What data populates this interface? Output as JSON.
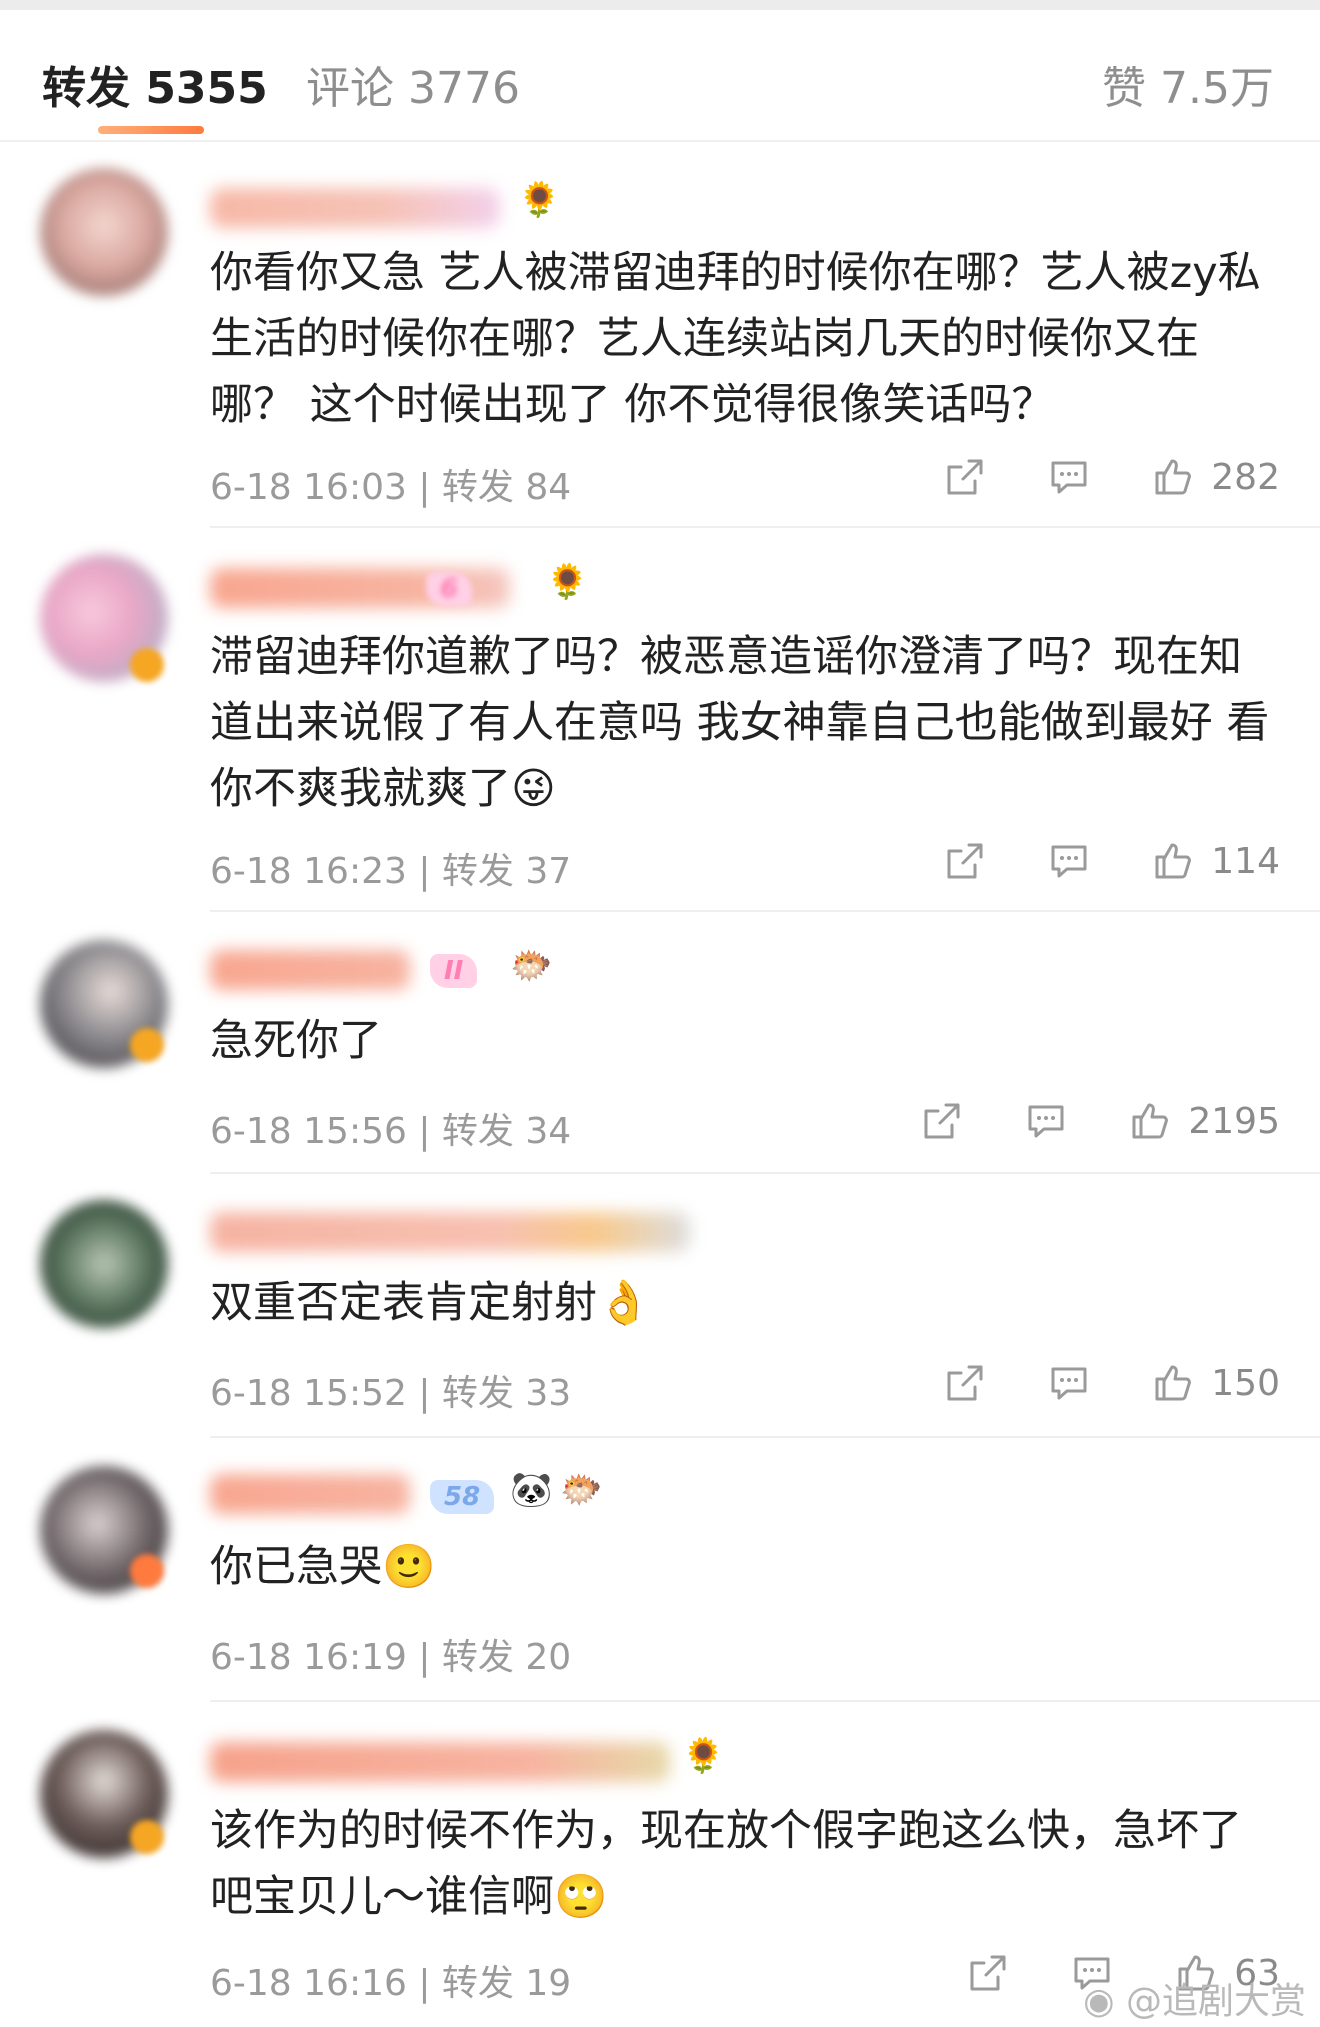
{
  "tabs": {
    "repost_label": "转发 5355",
    "comment_label": "评论 3776",
    "like_label": "赞 7.5万"
  },
  "comments": [
    {
      "text": "你看你又急 艺人被滞留迪拜的时候你在哪？艺人被zy私生活的时候你在哪？艺人连续站岗几天的时候你又在哪？ 这个时候出现了 你不觉得很像笑话吗？",
      "meta": "6-18 16:03 | 转发 84",
      "likes": "282"
    },
    {
      "text": "滞留迪拜你道歉了吗？被恶意造谣你澄清了吗？现在知道出来说假了有人在意吗 我女神靠自己也能做到最好 看你不爽我就爽了😜",
      "meta": "6-18 16:23 | 转发 37",
      "likes": "114",
      "level_tag": "6"
    },
    {
      "text": "急死你了",
      "meta": "6-18 15:56 | 转发 34",
      "likes": "2195",
      "level_tag": "II"
    },
    {
      "text": "双重否定表肯定射射👌",
      "meta": "6-18 15:52 | 转发 33",
      "likes": "150"
    },
    {
      "text": "你已急哭🙂",
      "meta": "6-18 16:19 | 转发 20",
      "level_tag": "58"
    },
    {
      "text": "该作为的时候不作为，现在放个假字跑这么快，急坏了吧宝贝儿～谁信啊🙄",
      "meta": "6-18 16:16 | 转发 19",
      "likes": "63"
    }
  ],
  "watermark": "@追剧大赏",
  "colors": {
    "accent": "#ff7a3d",
    "meta_gray": "#9a9a9a",
    "icon_gray": "#9a9a9a"
  },
  "icons": [
    "share-icon",
    "comment-icon",
    "like-icon",
    "sunflower-icon",
    "pufferfish-icon",
    "panda-icon",
    "weibo-logo-icon"
  ]
}
